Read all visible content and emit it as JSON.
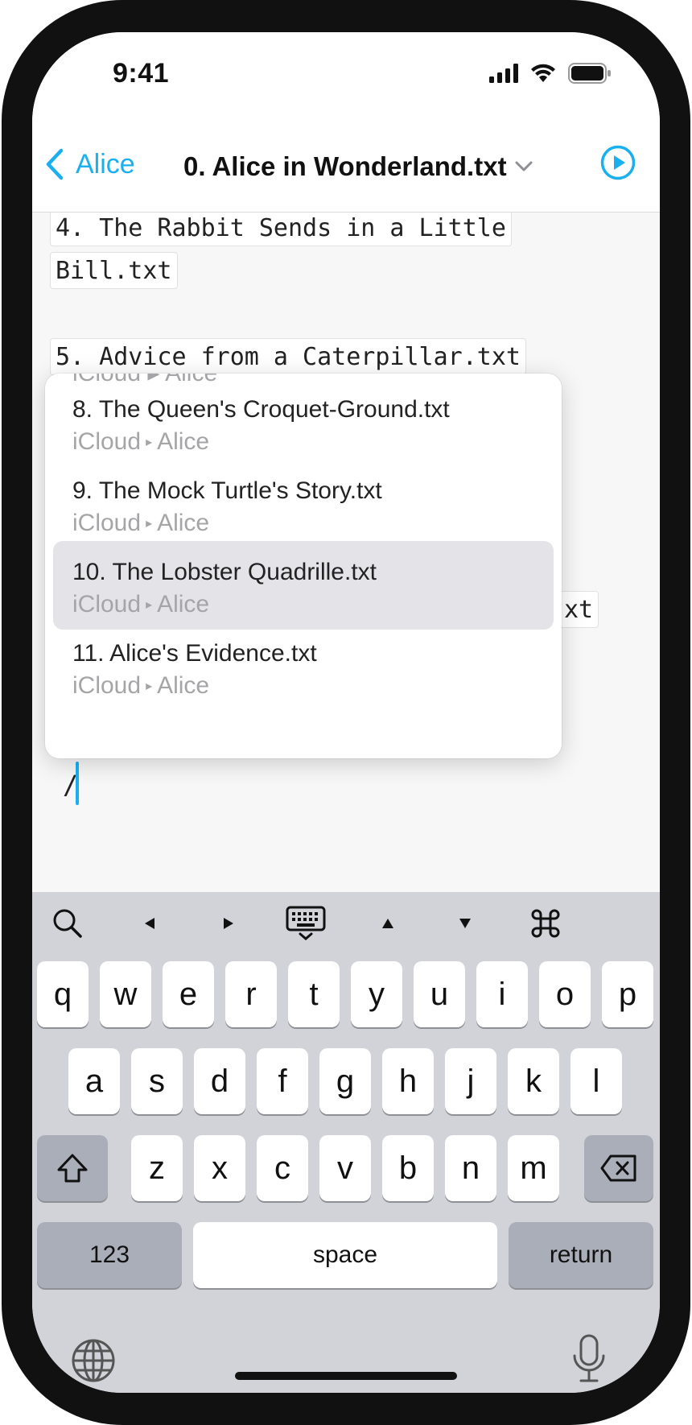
{
  "status": {
    "time": "9:41"
  },
  "nav": {
    "back_label": "Alice",
    "title": "0. Alice in Wonderland.txt"
  },
  "editor": {
    "lines": [
      "4. The Rabbit Sends in a Little",
      "Bill.txt",
      "5. Advice from a Caterpillar.txt",
      "xt"
    ],
    "cursor_text": "/"
  },
  "popup": {
    "peek_subtitle": "iCloud ▸ Alice",
    "items": [
      {
        "title": "8. The Queen's Croquet-Ground.txt",
        "location": "iCloud",
        "folder": "Alice",
        "selected": false
      },
      {
        "title": "9. The Mock Turtle's Story.txt",
        "location": "iCloud",
        "folder": "Alice",
        "selected": false
      },
      {
        "title": "10. The Lobster Quadrille.txt",
        "location": "iCloud",
        "folder": "Alice",
        "selected": true
      },
      {
        "title": "11. Alice's Evidence.txt",
        "location": "iCloud",
        "folder": "Alice",
        "selected": false
      }
    ]
  },
  "keyboard": {
    "row1": [
      "q",
      "w",
      "e",
      "r",
      "t",
      "y",
      "u",
      "i",
      "o",
      "p"
    ],
    "row2": [
      "a",
      "s",
      "d",
      "f",
      "g",
      "h",
      "j",
      "k",
      "l"
    ],
    "row3": [
      "z",
      "x",
      "c",
      "v",
      "b",
      "n",
      "m"
    ],
    "numbers_label": "123",
    "space_label": "space",
    "return_label": "return",
    "toolbar_icons": [
      "search-icon",
      "arrow-left-icon",
      "arrow-right-icon",
      "keyboard-dismiss-icon",
      "arrow-up-icon",
      "arrow-down-icon",
      "command-icon"
    ]
  },
  "colors": {
    "accent": "#1ab0f0",
    "selected_row": "#e4e4e8",
    "keyboard_bg": "#d1d3d9"
  }
}
